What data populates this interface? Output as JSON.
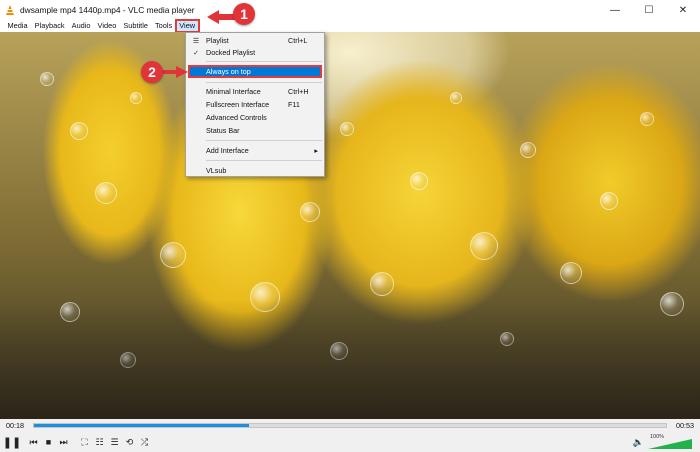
{
  "window": {
    "title": "dwsample mp4 1440p.mp4 - VLC media player",
    "controls": {
      "minimize": "—",
      "maximize": "☐",
      "close": "✕"
    }
  },
  "menubar": {
    "items": [
      {
        "label": "Media"
      },
      {
        "label": "Playback"
      },
      {
        "label": "Audio"
      },
      {
        "label": "Video"
      },
      {
        "label": "Subtitle"
      },
      {
        "label": "Tools"
      },
      {
        "label": "View"
      }
    ]
  },
  "view_menu": {
    "items": [
      {
        "label": "Playlist",
        "shortcut": "Ctrl+L",
        "icon": "playlist-icon"
      },
      {
        "label": "Docked Playlist",
        "shortcut": "",
        "checked": true
      },
      {
        "label": "Always on top",
        "shortcut": "",
        "highlighted": true
      },
      {
        "label": "Minimal Interface",
        "shortcut": "Ctrl+H"
      },
      {
        "label": "Fullscreen Interface",
        "shortcut": "F11"
      },
      {
        "label": "Advanced Controls",
        "shortcut": ""
      },
      {
        "label": "Status Bar",
        "shortcut": ""
      },
      {
        "label": "Add Interface",
        "shortcut": "",
        "submenu": true
      },
      {
        "label": "VLsub",
        "shortcut": ""
      }
    ]
  },
  "annotations": {
    "step1": "1",
    "step2": "2"
  },
  "playback": {
    "elapsed": "00:18",
    "total": "00:53",
    "progress_fraction": 0.34,
    "volume_label": "100%",
    "volume_fraction": 1.0
  },
  "colors": {
    "accent": "#0078d7",
    "annotation": "#e0333a",
    "seek_fill": "#1e8ee0",
    "volume": "#22b14c"
  }
}
